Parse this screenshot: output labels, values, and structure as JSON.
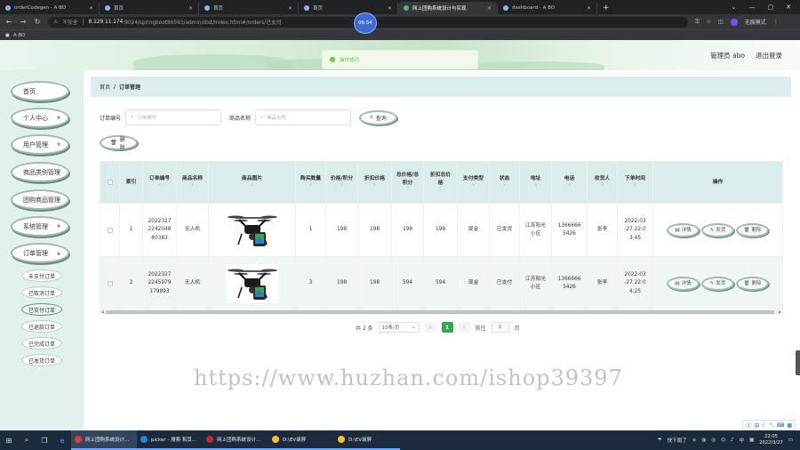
{
  "browser": {
    "tabs": [
      {
        "label": "orderCodegen - A BO",
        "active": false
      },
      {
        "label": "首页",
        "active": false
      },
      {
        "label": "首页",
        "active": false
      },
      {
        "label": "首页",
        "active": false
      },
      {
        "label": "网上团购系统设计与实现",
        "active": true
      },
      {
        "label": "dashboard - A BO",
        "active": false
      }
    ],
    "new_tab": "+",
    "security": "不安全",
    "url_host": "8.129.11.174",
    "url_path": ":9024/springboot86593/admin/dist/index.html#/orders/已支付",
    "profile_label": "无痕模式",
    "bookmark": "A BO",
    "timer": "06:54"
  },
  "header": {
    "toast": "操作成功",
    "admin_label": "管理员 abo",
    "logout_label": "退出登录"
  },
  "sidebar": {
    "items": [
      {
        "label": "首页",
        "has_chevron": false
      },
      {
        "label": "个人中心",
        "has_chevron": true
      },
      {
        "label": "用户管理",
        "has_chevron": true
      },
      {
        "label": "商品类别管理",
        "has_chevron": false
      },
      {
        "label": "团购商品管理",
        "has_chevron": false
      },
      {
        "label": "系统管理",
        "has_chevron": true
      },
      {
        "label": "订单管理",
        "has_chevron": true
      }
    ],
    "sub_items": [
      {
        "label": "未支付订单",
        "active": false
      },
      {
        "label": "已取消订单",
        "active": false
      },
      {
        "label": "已支付订单",
        "active": true
      },
      {
        "label": "已退款订单",
        "active": false
      },
      {
        "label": "已完成订单",
        "active": false
      },
      {
        "label": "已发货订单",
        "active": false
      }
    ]
  },
  "breadcrumb": {
    "home": "首页",
    "sep": "/",
    "current": "订单管理"
  },
  "search": {
    "order_label": "订单编号",
    "order_placeholder": "订单编号",
    "name_label": "商品名称",
    "name_placeholder": "商品名称",
    "query_button": "查询",
    "delete_button": "删除"
  },
  "table": {
    "headers": [
      "索引",
      "订单编号",
      "商品名称",
      "商品图片",
      "购买数量",
      "价格/积分",
      "折扣价格",
      "总价格/总积分",
      "折扣总价格",
      "支付类型",
      "状态",
      "地址",
      "电话",
      "收货人",
      "下单时间",
      "操作"
    ],
    "rows": [
      {
        "index": "1",
        "order_no": "2022327 2242048 80383",
        "product": "无人机",
        "qty": "1",
        "price": "198",
        "discount_price": "198",
        "total": "198",
        "discount_total": "198",
        "pay_type": "现金",
        "status": "已发货",
        "address": "江苏阳光 小区",
        "phone": "1366666 5426",
        "receiver": "张李",
        "time": "2022-03 -27 22:0 3:45"
      },
      {
        "index": "2",
        "order_no": "2022327 2245979 179893",
        "product": "无人机",
        "qty": "3",
        "price": "198",
        "discount_price": "198",
        "total": "594",
        "discount_total": "594",
        "pay_type": "现金",
        "status": "已支付",
        "address": "江苏阳光 小区",
        "phone": "1366666 5426",
        "receiver": "张李",
        "time": "2022-03 -27 22:0 4:25"
      }
    ],
    "actions": {
      "detail": "详情",
      "ship": "发货",
      "delete": "删除"
    }
  },
  "pagination": {
    "total": "共 2 条",
    "page_size": "10条/页",
    "prev": "<",
    "current": "1",
    "next": ">",
    "goto": "前往",
    "goto_value": "1",
    "page_unit": "页"
  },
  "watermark": "https://www.huzhan.com/ishop39397",
  "ime": "中",
  "taskbar": {
    "apps": [
      {
        "label": "网上团购系统设计...",
        "color": "#e53935",
        "active": true
      },
      {
        "label": "picker - 搜索 和其...",
        "color": "#1e88e5",
        "active": false
      },
      {
        "label": "网上团购系统设计...",
        "color": "#c62828",
        "active": false
      },
      {
        "label": "D:\\EV录屏",
        "color": "#fbc02d",
        "active": false
      },
      {
        "label": "D:\\EV录屏",
        "color": "#fbc02d",
        "active": false
      }
    ],
    "weather": "快下雨了",
    "lang": "中",
    "time": "22:05",
    "date": "2022/3/27"
  }
}
